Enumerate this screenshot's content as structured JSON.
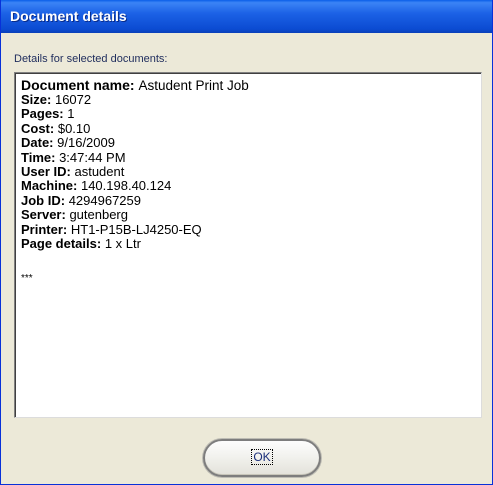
{
  "window": {
    "title": "Document details"
  },
  "dialog": {
    "subtitle": "Details for selected documents:",
    "details": [
      {
        "key": "Document name:",
        "value": "Astudent Print Job"
      },
      {
        "key": "Size:",
        "value": "16072"
      },
      {
        "key": "Pages:",
        "value": "1"
      },
      {
        "key": "Cost:",
        "value": "$0.10"
      },
      {
        "key": "Date:",
        "value": "9/16/2009"
      },
      {
        "key": "Time:",
        "value": "3:47:44 PM"
      },
      {
        "key": "User ID:",
        "value": "astudent"
      },
      {
        "key": "Machine:",
        "value": "140.198.40.124"
      },
      {
        "key": "Job ID:",
        "value": "4294967259"
      },
      {
        "key": "Server:",
        "value": "gutenberg"
      },
      {
        "key": "Printer:",
        "value": "HT1-P15B-LJ4250-EQ"
      },
      {
        "key": "Page details:",
        "value": "1 x Ltr"
      }
    ],
    "footer_mark": "***",
    "ok_label": "OK"
  },
  "colors": {
    "titlebar": "#0b4bd2",
    "window_background": "#ece9d8",
    "title_text": "#ffffff"
  }
}
